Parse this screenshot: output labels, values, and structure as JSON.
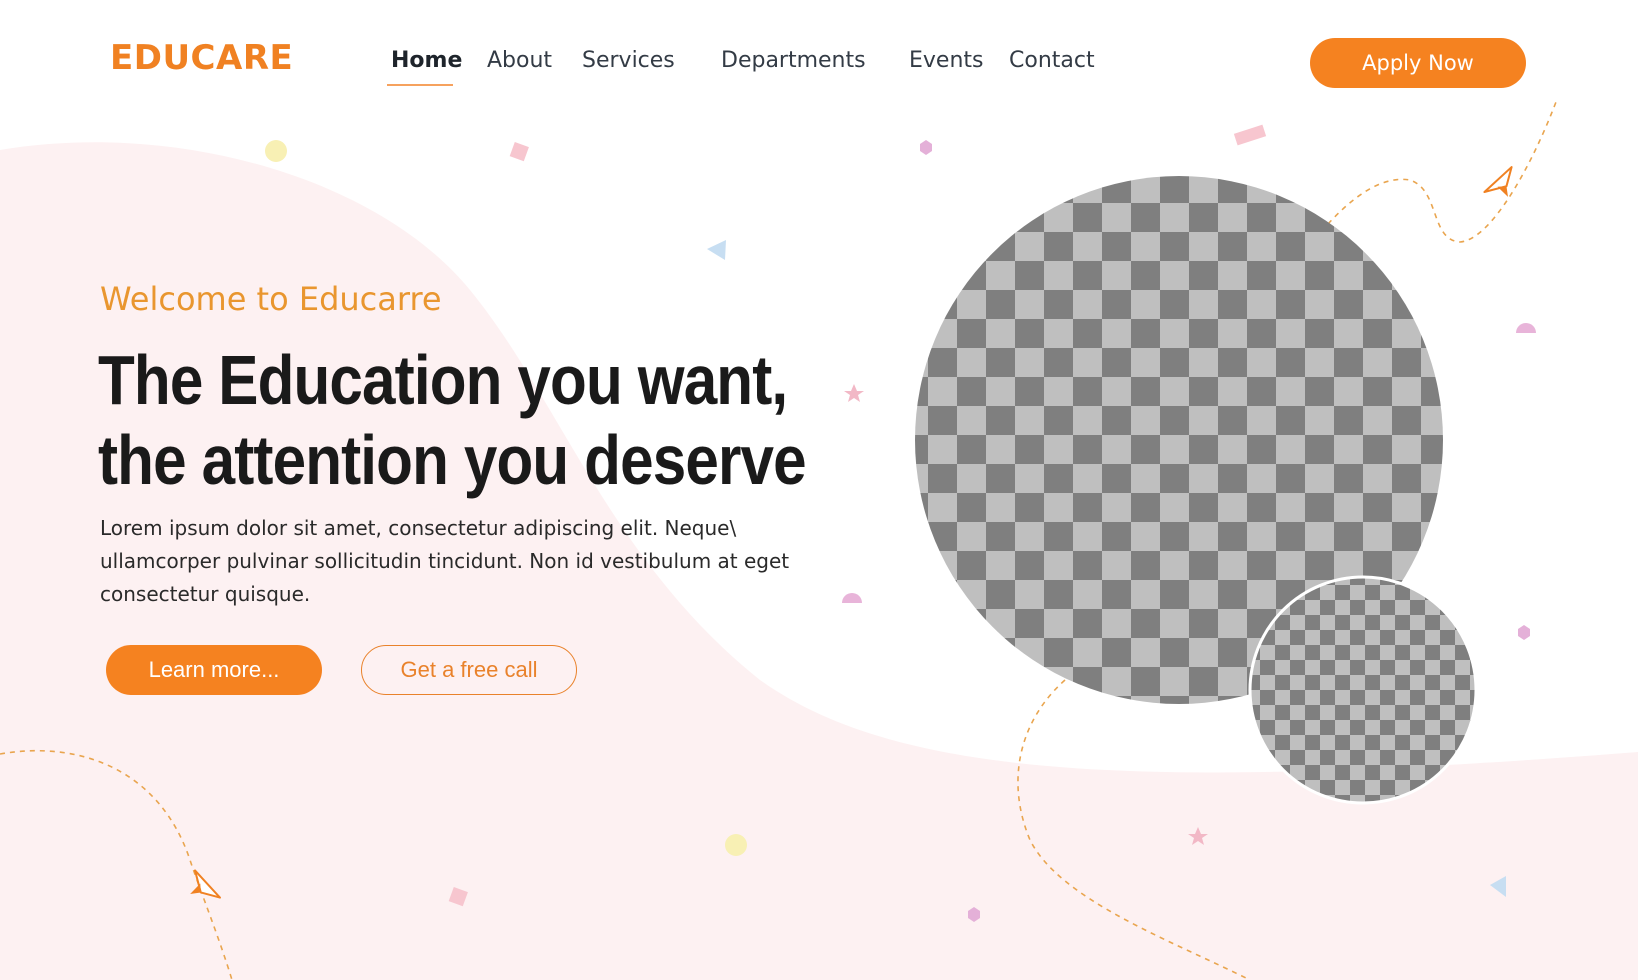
{
  "brand": {
    "logo_text": "EDUCARE"
  },
  "nav": {
    "items": [
      {
        "label": "Home",
        "active": true
      },
      {
        "label": "About",
        "active": false
      },
      {
        "label": "Services",
        "active": false
      },
      {
        "label": "Departments",
        "active": false
      },
      {
        "label": "Events",
        "active": false
      },
      {
        "label": "Contact",
        "active": false
      }
    ],
    "cta_label": "Apply Now"
  },
  "hero": {
    "welcome": "Welcome to Educarre",
    "headline_line1": "The Education you want,",
    "headline_line2": "the attention you deserve",
    "description_line1": "Lorem ipsum dolor sit amet, consectetur adipiscing elit. Neque\\",
    "description_line2": "ullamcorper pulvinar sollicitudin tincidunt. Non id vestibulum at eget",
    "description_line3": "consectetur quisque.",
    "primary_button": "Learn more...",
    "secondary_button": "Get a free call"
  },
  "colors": {
    "accent": "#f58220",
    "welcome": "#e9962f",
    "background_blob": "#fdf1f2",
    "heading": "#1a1a1a",
    "placeholder_dark": "#7f7f7f",
    "placeholder_light": "#bfbfbf"
  },
  "images": {
    "large_placeholder": "transparent-placeholder-image",
    "small_placeholder": "transparent-placeholder-image"
  }
}
